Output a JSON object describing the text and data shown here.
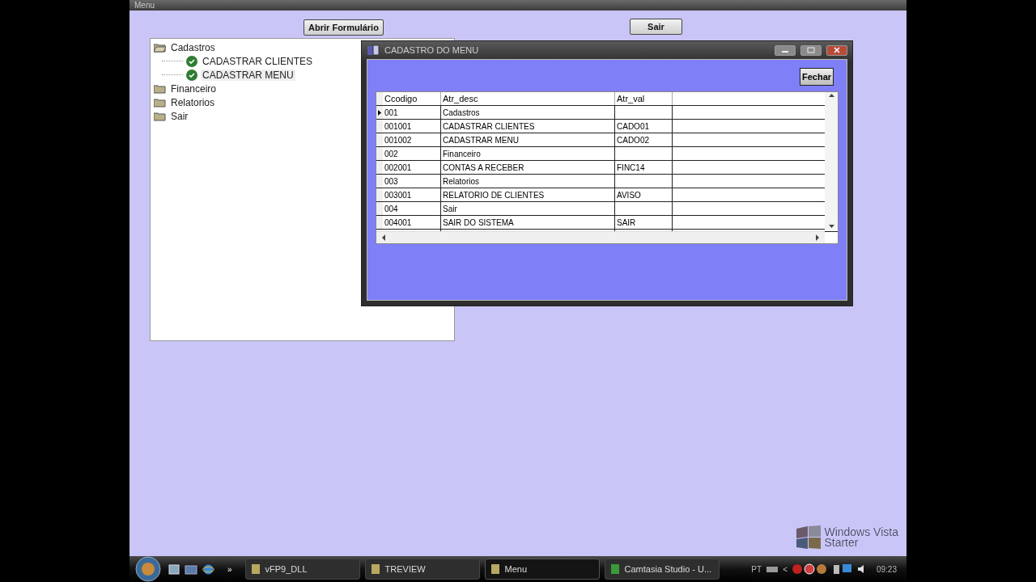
{
  "window": {
    "title": "Menu"
  },
  "buttons": [
    {
      "label": "Abrir Formulário"
    },
    {
      "label": "Sair"
    }
  ],
  "tree": [
    {
      "label": "Cadastros",
      "expanded": true,
      "selected": false,
      "children": [
        {
          "label": "CADASTRAR CLIENTES",
          "selected": false
        },
        {
          "label": "CADASTRAR MENU",
          "selected": true
        }
      ]
    },
    {
      "label": "Financeiro",
      "expanded": false,
      "selected": false
    },
    {
      "label": "Relatorios",
      "expanded": false,
      "selected": false
    },
    {
      "label": "Sair",
      "expanded": false,
      "selected": false
    }
  ],
  "child_window": {
    "title": "CADASTRO DO MENU",
    "close_button": "Fechar",
    "table": {
      "columns": [
        "Ccodigo",
        "Atr_desc",
        "Atr_val"
      ],
      "rows": [
        {
          "cells": [
            "001",
            "Cadastros",
            ""
          ],
          "selected": true
        },
        {
          "cells": [
            "001001",
            "CADASTRAR CLIENTES",
            "CADO01"
          ],
          "selected": false
        },
        {
          "cells": [
            "001002",
            "CADASTRAR MENU",
            "CADO02"
          ],
          "selected": false
        },
        {
          "cells": [
            "002",
            "Financeiro",
            ""
          ],
          "selected": false
        },
        {
          "cells": [
            "002001",
            "CONTAS A RECEBER",
            "FINC14"
          ],
          "selected": false
        },
        {
          "cells": [
            "003",
            "Relatorios",
            ""
          ],
          "selected": false
        },
        {
          "cells": [
            "003001",
            "RELATORIO DE CLIENTES",
            "AVISO"
          ],
          "selected": false
        },
        {
          "cells": [
            "004",
            "Sair",
            ""
          ],
          "selected": false
        },
        {
          "cells": [
            "004001",
            "SAIR DO SISTEMA",
            "SAIR"
          ],
          "selected": false
        }
      ]
    }
  },
  "desktop_watermark": [
    "Windows Vista",
    "Starter"
  ],
  "taskbar": {
    "overflow": "»",
    "tasks": [
      {
        "label": "vFP9_DLL",
        "selected": false
      },
      {
        "label": "TREVIEW",
        "selected": false
      },
      {
        "label": "Menu",
        "selected": true
      },
      {
        "label": "Camtasia Studio - U...",
        "selected": false
      }
    ],
    "language": "PT",
    "tray_expand": "<",
    "clock": "09:23"
  }
}
